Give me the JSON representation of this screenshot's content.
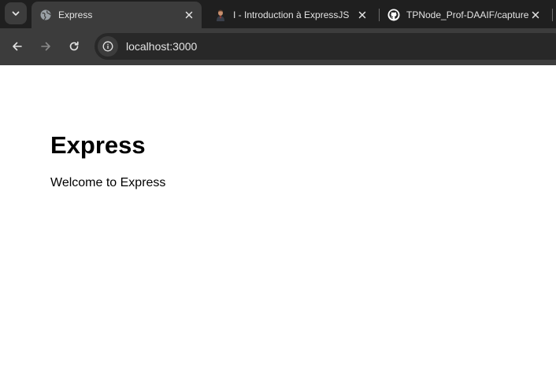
{
  "tabs": [
    {
      "title": "Express",
      "favicon": "globe-icon",
      "active": true
    },
    {
      "title": "I - Introduction à ExpressJS",
      "favicon": "avatar-icon",
      "active": false
    },
    {
      "title": "TPNode_Prof-DAAIF/capture",
      "favicon": "github-icon",
      "active": false
    }
  ],
  "address_bar": {
    "host": "localhost",
    "port": ":3000"
  },
  "page": {
    "heading": "Express",
    "paragraph": "Welcome to Express"
  },
  "colors": {
    "tabstrip": "#1f1f1f",
    "toolbar": "#3c3c3c",
    "omnibox": "#282828",
    "text": "#e3e3e3"
  }
}
